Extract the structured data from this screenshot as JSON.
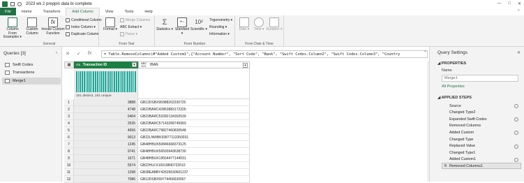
{
  "window": {
    "title": "2023 wk 2 preppin data bi complete",
    "controls": [
      "—",
      "□",
      "✕"
    ]
  },
  "tabs": [
    {
      "label": "File"
    },
    {
      "label": "Home"
    },
    {
      "label": "Transform"
    },
    {
      "label": "Add Column"
    },
    {
      "label": "View"
    },
    {
      "label": "Tools"
    },
    {
      "label": "Help"
    }
  ],
  "ribbon": {
    "general": {
      "label": "General",
      "column_from_examples": "Column From Examples ▾",
      "custom_column": "Custom Column",
      "invoke_custom_function": "Invoke Custom Function",
      "conditional_column": "Conditional Column",
      "index_column": "Index Column ▾",
      "duplicate_column": "Duplicate Column"
    },
    "from_text": {
      "label": "From Text",
      "format": "Format ▾",
      "merge_columns": "Merge Columns",
      "extract": "ABC Extract ▾",
      "parse": "Parse ▾"
    },
    "from_number": {
      "label": "From Number",
      "statistics": "Statistics ▾",
      "standard": "Standard ▾",
      "scientific": "Scientific ▾",
      "trigonometry": "Trigonometry ▾",
      "rounding": "Rounding ▾",
      "information": "Information ▾"
    },
    "from_date_time": {
      "label": "From Date & Time",
      "date": "Date ▾",
      "time": "Time ▾",
      "duration": "Duration ▾"
    }
  },
  "queries": {
    "header": "Queries [3]",
    "items": [
      {
        "label": "Swift Codes"
      },
      {
        "label": "Transactions"
      },
      {
        "label": "Merge1"
      }
    ]
  },
  "formula": {
    "text": "= Table.RemoveColumns(#\"Added Custom1\",{\"Account Number\", \"Sort Code\", \"Bank\", \"Swift Codes.Column2\", \"Swift Codes.Column3\", \"Country"
  },
  "grid": {
    "columns": [
      {
        "type": "1²3",
        "name": "Transaction ID"
      },
      {
        "type": "ABC 123",
        "name": "IBAN"
      }
    ],
    "profile_text": "101 distinct, 101 unique",
    "rows": [
      {
        "n": "1",
        "tid": "3888",
        "iban": "GB12DSBX95988262230725"
      },
      {
        "n": "2",
        "tid": "4748",
        "iban": "GB22BARC42863883172326"
      },
      {
        "n": "3",
        "tid": "5404",
        "iban": "GB22BARC53282134302539"
      },
      {
        "n": "4",
        "tid": "2535",
        "iban": "GB22BARC57143268745993"
      },
      {
        "n": "5",
        "tid": "4656",
        "iban": "GB22BARC79827460830548"
      },
      {
        "n": "6",
        "tid": "9013",
        "iban": "GB22LNWBK93877113350031"
      },
      {
        "n": "7",
        "tid": "1245",
        "iban": "GB48HBUK50846668373125"
      },
      {
        "n": "8",
        "tid": "9741",
        "iban": "GB48HBUK56593943638730"
      },
      {
        "n": "9",
        "tid": "1671",
        "iban": "GB48HBUK19554477144031"
      },
      {
        "n": "10",
        "tid": "5574",
        "iban": "GB22HLFX10019840722610"
      },
      {
        "n": "11",
        "tid": "1298",
        "iban": "GB38EABBY42635630601237"
      },
      {
        "n": "12",
        "tid": "7086",
        "iban": "GB12DSBX59774456630557"
      }
    ]
  },
  "settings": {
    "header": "Query Settings",
    "properties_header": "PROPERTIES",
    "name_label": "Name",
    "name_value": "Merge1",
    "all_properties": "All Properties",
    "applied_steps_header": "APPLIED STEPS",
    "steps": [
      {
        "label": "Source",
        "gear": true
      },
      {
        "label": "Changed Type2",
        "gear": false
      },
      {
        "label": "Expanded Swift Codes",
        "gear": true
      },
      {
        "label": "Removed Columns",
        "gear": false
      },
      {
        "label": "Added Custom",
        "gear": true
      },
      {
        "label": "Changed Type",
        "gear": false
      },
      {
        "label": "Replaced Value",
        "gear": true
      },
      {
        "label": "Changed Type1",
        "gear": false
      },
      {
        "label": "Added Custom1",
        "gear": true
      },
      {
        "label": "Removed Columns1",
        "gear": false
      }
    ]
  },
  "colors": {
    "accent": "#217346",
    "column_header": "#1e7f44",
    "profile_bar": "#1aa99a"
  }
}
